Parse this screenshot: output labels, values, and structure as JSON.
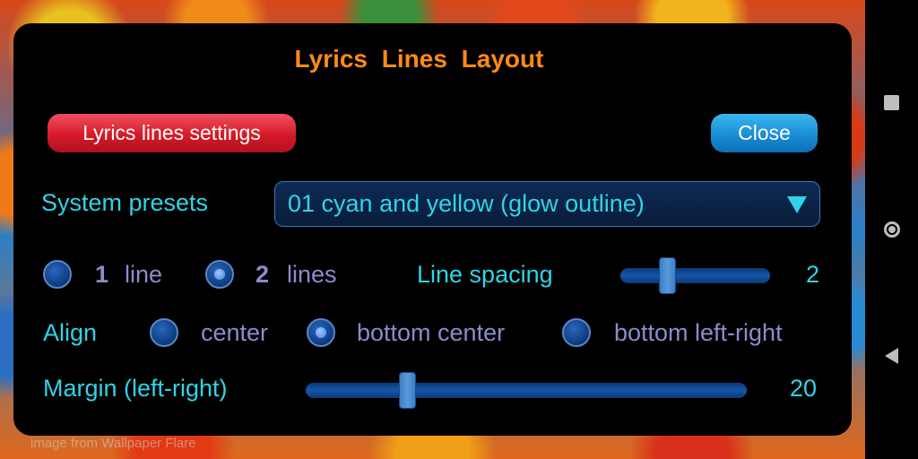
{
  "dialog": {
    "title": "Lyrics  Lines  Layout",
    "settings_button": "Lyrics lines settings",
    "close_button": "Close",
    "system_presets": {
      "label": "System presets",
      "selected": "01 cyan and yellow (glow outline)"
    },
    "lines": {
      "option1_num": "1",
      "option1_label": "line",
      "option2_num": "2",
      "option2_label": "lines",
      "selected": "2 lines"
    },
    "line_spacing": {
      "label": "Line spacing",
      "value": "2",
      "fraction": 0.29
    },
    "align": {
      "label": "Align",
      "options": [
        "center",
        "bottom center",
        "bottom left-right"
      ],
      "selected": "bottom center"
    },
    "margin": {
      "label": "Margin (left-right)",
      "value": "20",
      "fraction": 0.22
    }
  },
  "watermark": "image from Wallpaper Flare",
  "navbar": {
    "icons": [
      "recents-square-icon",
      "home-circle-icon",
      "back-triangle-icon"
    ]
  },
  "colors": {
    "title": "#ff8a14",
    "cyan_text": "#2fd4e6",
    "lavender_text": "#8a8ccc",
    "settings_button": "#d61a28",
    "close_button": "#1a8ed6"
  }
}
